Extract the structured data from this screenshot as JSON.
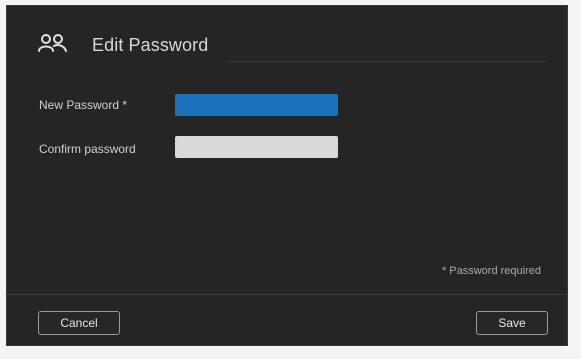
{
  "dialog": {
    "title": "Edit Password",
    "header_icon": "users-icon"
  },
  "form": {
    "new_password_label": "New Password *",
    "new_password_value": "",
    "confirm_password_label": "Confirm password",
    "confirm_password_value": "",
    "required_note": "* Password required"
  },
  "footer": {
    "cancel_label": "Cancel",
    "save_label": "Save"
  },
  "colors": {
    "dialog_background": "#252525",
    "active_field": "#1a72bc",
    "inactive_field": "#d9d9d9"
  }
}
